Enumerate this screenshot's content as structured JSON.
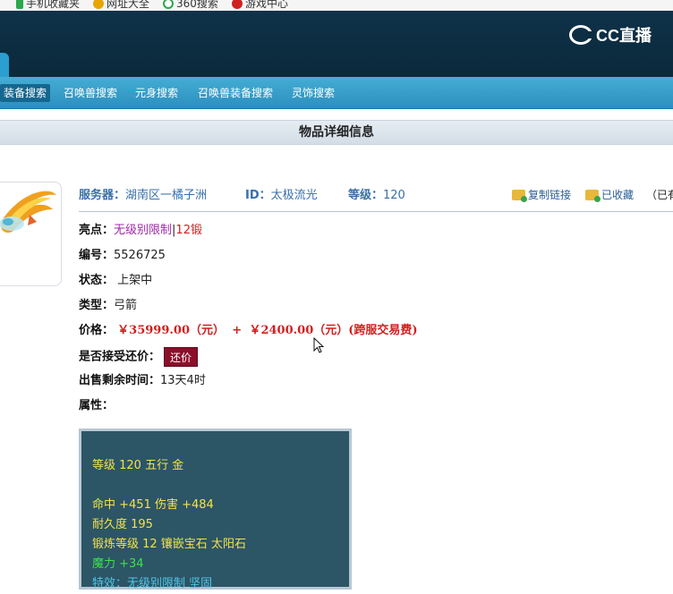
{
  "bookmarks": [
    {
      "label": "手机收藏夹",
      "icon": "phone-icon",
      "color": "#2aa84a"
    },
    {
      "label": "网址大全",
      "icon": "star-icon",
      "color": "#e8a400"
    },
    {
      "label": "360搜索",
      "icon": "search-icon",
      "color": "#2aa84a"
    },
    {
      "label": "游戏中心",
      "icon": "game-icon",
      "color": "#d02020"
    }
  ],
  "header": {
    "logo_text": "CC直播"
  },
  "nav": {
    "items": [
      {
        "label": "装备搜索"
      },
      {
        "label": "召唤兽搜索"
      },
      {
        "label": "元身搜索"
      },
      {
        "label": "召唤兽装备搜索"
      },
      {
        "label": "灵饰搜索"
      }
    ]
  },
  "title": "物品详细信息",
  "info": {
    "server_label": "服务器：",
    "server_value": "湖南区一橘子洲",
    "id_label": "ID：",
    "id_value": "太极流光",
    "level_label": "等级：",
    "level_value": "120",
    "copy_link": "复制链接",
    "favorited": "已收藏",
    "trailing": "（已有"
  },
  "details": {
    "highlight_label": "亮点：",
    "highlight_value1": "无级别限制",
    "highlight_sep": "|",
    "highlight_value2": "12锻",
    "number_label": "编号：",
    "number_value": "5526725",
    "status_label": "状态：",
    "status_value": "上架中",
    "type_label": "类型：",
    "type_value": "弓箭",
    "price_label": "价格：",
    "price_value": "￥35999.00（元）",
    "price_plus": "+",
    "fee_value": "￥2400.00（元）(跨服交易费)",
    "haggle_label": "是否接受还价：",
    "haggle_button": "还价",
    "remaining_label": "出售剩余时间：",
    "remaining_value": "13天4时",
    "attr_label": "属性："
  },
  "attributes": {
    "line1": "等级 120 五行 金",
    "line2": "命中 +451 伤害 +484",
    "line3": "耐久度 195",
    "line4": "锻炼等级 12 镶嵌宝石 太阳石",
    "line5": "魔力 +34",
    "line6": "特效：无级别限制 坚固"
  }
}
